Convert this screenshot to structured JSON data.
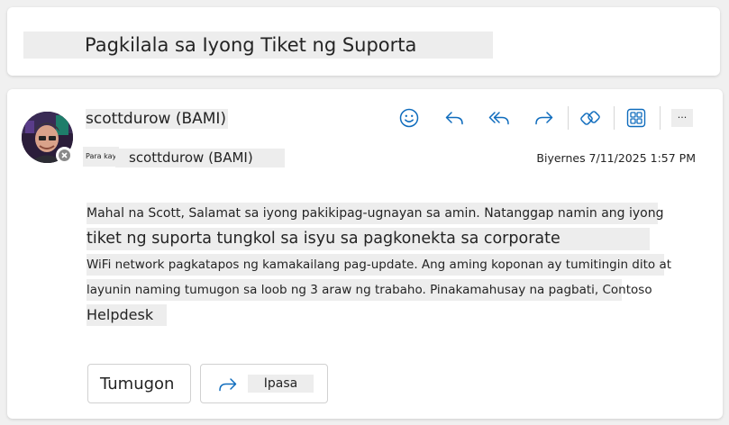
{
  "subject": "Pagkilala sa Iyong Tiket ng Suporta",
  "sender": {
    "name": "scottdurow (BAMI)"
  },
  "recipient": {
    "to_label": "Para kay",
    "name": "scottdurow (BAMI)"
  },
  "date": "Biyernes 7/11/2025 1:57 PM",
  "toolbar": {
    "emoji_icon": "emoji-icon",
    "reply_icon": "reply-icon",
    "reply_all_icon": "reply-all-icon",
    "forward_icon": "forward-icon",
    "loop_icon": "loop-icon",
    "apps_icon": "apps-icon",
    "more_label": "..."
  },
  "body": {
    "lines": [
      "Mahal na Scott, Salamat sa iyong pakikipag-ugnayan sa amin. Natanggap namin ang iyong",
      "tiket ng suporta tungkol sa isyu sa pagkonekta sa corporate",
      "WiFi network pagkatapos ng kamakailang pag-update. Ang aming koponan ay tumitingin dito at",
      "layunin naming tumugon sa loob ng 3 araw ng trabaho. Pinakamahusay na pagbati, Contoso",
      "Helpdesk"
    ]
  },
  "actions": {
    "reply_label": "Tumugon",
    "forward_label": "Ipasa"
  },
  "colors": {
    "accent": "#0f6cbd",
    "highlight": "#ededed",
    "page_bg": "#f0f0f0"
  }
}
